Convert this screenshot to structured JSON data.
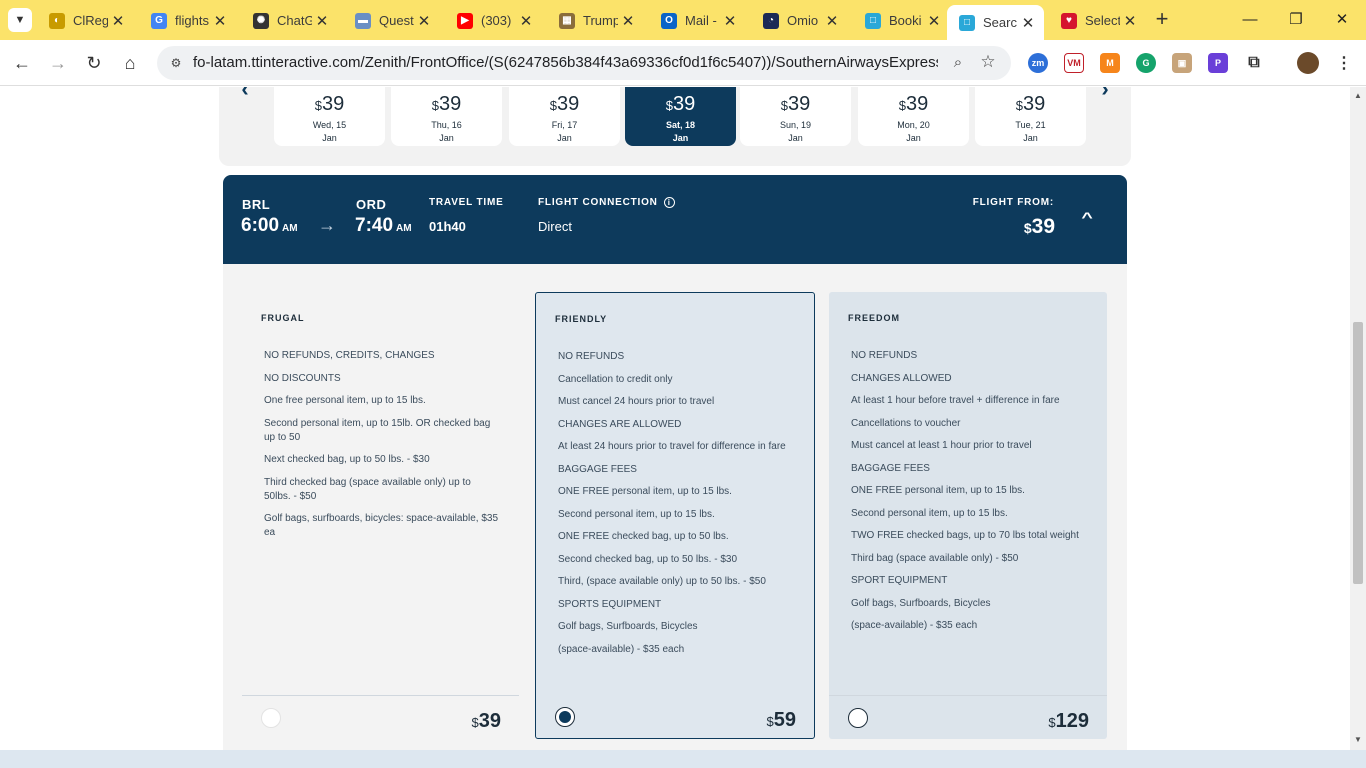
{
  "browser": {
    "tabs": [
      {
        "title": "ClRegi",
        "icon": "globe-icon",
        "color": "#c89b00"
      },
      {
        "title": "flights",
        "icon": "google-icon",
        "color": "#4285f4"
      },
      {
        "title": "ChatGPT",
        "icon": "openai-icon",
        "color": "#333333"
      },
      {
        "title": "Questi",
        "icon": "app-icon",
        "color": "#6a8fc4"
      },
      {
        "title": "(303)",
        "icon": "youtube-icon",
        "color": "#ff0000"
      },
      {
        "title": "Trump",
        "icon": "news-icon",
        "color": "#8a6d3b"
      },
      {
        "title": "Mail -",
        "icon": "outlook-icon",
        "color": "#0a64c8"
      },
      {
        "title": "Omio",
        "icon": "omio-icon",
        "color": "#1b2a56"
      },
      {
        "title": "Booki",
        "icon": "booking-icon",
        "color": "#2aa8d8"
      },
      {
        "title": "Searc",
        "icon": "booking-icon",
        "color": "#2aa8d8"
      },
      {
        "title": "Select",
        "icon": "southwest-icon",
        "color": "#d5152e"
      }
    ],
    "url": "fo-latam.ttinteractive.com/Zenith/FrontOffice/(S(6247856b384f43a69336cf0d1f6c5407))/SouthernAirwaysExpress/en-U...",
    "extensions": [
      "zm",
      "VM",
      "MM",
      "G",
      "box",
      "P"
    ]
  },
  "dates": [
    {
      "price": "39",
      "currency": "$",
      "day": "Wed, 15",
      "month": "Jan",
      "selected": false
    },
    {
      "price": "39",
      "currency": "$",
      "day": "Thu, 16",
      "month": "Jan",
      "selected": false
    },
    {
      "price": "39",
      "currency": "$",
      "day": "Fri, 17",
      "month": "Jan",
      "selected": false
    },
    {
      "price": "39",
      "currency": "$",
      "day": "Sat, 18",
      "month": "Jan",
      "selected": true
    },
    {
      "price": "39",
      "currency": "$",
      "day": "Sun, 19",
      "month": "Jan",
      "selected": false
    },
    {
      "price": "39",
      "currency": "$",
      "day": "Mon, 20",
      "month": "Jan",
      "selected": false
    },
    {
      "price": "39",
      "currency": "$",
      "day": "Tue, 21",
      "month": "Jan",
      "selected": false
    }
  ],
  "flight": {
    "origin": "BRL",
    "depart_time": "6:00",
    "depart_ampm": "AM",
    "destination": "ORD",
    "arrive_time": "7:40",
    "arrive_ampm": "AM",
    "travel_time_label": "TRAVEL TIME",
    "travel_time": "01h40",
    "connection_label": "FLIGHT CONNECTION",
    "connection": "Direct",
    "from_label": "FLIGHT FROM:",
    "from_currency": "$",
    "from_price": "39"
  },
  "fares": {
    "frugal": {
      "name": "FRUGAL",
      "currency": "$",
      "price": "39",
      "selected": false,
      "items": [
        "NO REFUNDS, CREDITS, CHANGES",
        "NO DISCOUNTS",
        "One free personal item, up to 15 lbs.",
        "Second personal item, up to 15lb. OR checked bag up to 50",
        "Next checked bag, up to 50 lbs. - $30",
        "Third checked bag (space available only) up to 50lbs. - $50",
        "Golf bags, surfboards, bicycles: space-available, $35 ea"
      ]
    },
    "friendly": {
      "name": "FRIENDLY",
      "currency": "$",
      "price": "59",
      "selected": true,
      "items": [
        "NO REFUNDS",
        "Cancellation to credit only",
        "Must cancel 24 hours prior to travel",
        "CHANGES ARE ALLOWED",
        "At least 24 hours prior to travel for difference in fare",
        "BAGGAGE FEES",
        "ONE FREE personal item, up to 15 lbs.",
        "Second personal item, up to 15 lbs.",
        "ONE FREE checked bag, up to 50 lbs.",
        "Second checked bag, up to 50 lbs. - $30",
        "Third, (space available only) up to 50 lbs. - $50",
        "SPORTS EQUIPMENT",
        "Golf bags, Surfboards, Bicycles",
        "(space-available) - $35 each"
      ]
    },
    "freedom": {
      "name": "FREEDOM",
      "currency": "$",
      "price": "129",
      "selected": false,
      "items": [
        "NO REFUNDS",
        "CHANGES ALLOWED",
        "At least 1 hour before travel + difference in fare",
        "Cancellations to voucher",
        "Must cancel at least 1 hour prior to travel",
        "BAGGAGE FEES",
        "ONE FREE personal item, up to 15 lbs.",
        "Second personal item, up to 15 lbs.",
        "TWO FREE checked bags, up to 70 lbs total weight",
        "Third bag (space available only) - $50",
        "SPORT EQUIPMENT",
        "Golf bags, Surfboards, Bicycles",
        "(space-available) - $35 each"
      ]
    }
  },
  "colors": {
    "brand_navy": "#0d3a5c",
    "tabbar": "#fbe36a",
    "fare_bg": "#dfe7ee"
  }
}
